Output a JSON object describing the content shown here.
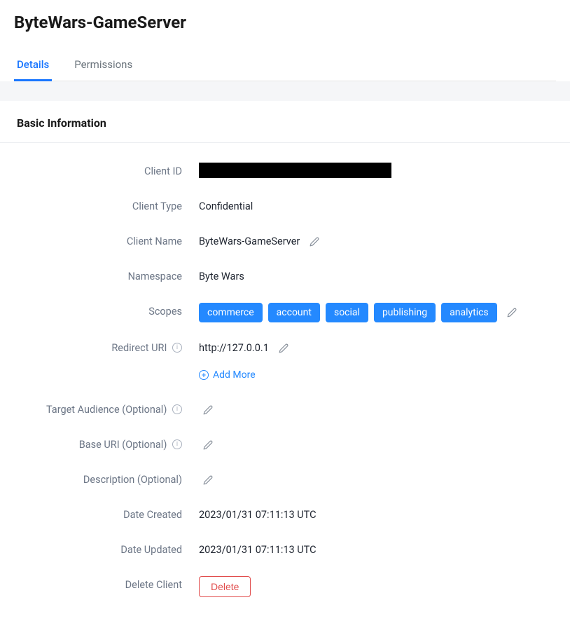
{
  "page": {
    "title": "ByteWars-GameServer"
  },
  "tabs": [
    {
      "label": "Details",
      "active": true
    },
    {
      "label": "Permissions",
      "active": false
    }
  ],
  "card": {
    "title": "Basic Information"
  },
  "fields": {
    "client_id": {
      "label": "Client ID"
    },
    "client_type": {
      "label": "Client Type",
      "value": "Confidential"
    },
    "client_name": {
      "label": "Client Name",
      "value": "ByteWars-GameServer"
    },
    "namespace": {
      "label": "Namespace",
      "value": "Byte Wars"
    },
    "scopes": {
      "label": "Scopes",
      "values": [
        "commerce",
        "account",
        "social",
        "publishing",
        "analytics"
      ]
    },
    "redirect_uri": {
      "label": "Redirect URI",
      "value": "http://127.0.0.1",
      "add_more_label": "Add More"
    },
    "target_audience": {
      "label": "Target Audience (Optional)"
    },
    "base_uri": {
      "label": "Base URI (Optional)"
    },
    "description": {
      "label": "Description (Optional)"
    },
    "date_created": {
      "label": "Date Created",
      "value": "2023/01/31 07:11:13 UTC"
    },
    "date_updated": {
      "label": "Date Updated",
      "value": "2023/01/31 07:11:13 UTC"
    },
    "delete_client": {
      "label": "Delete Client",
      "button_label": "Delete"
    }
  }
}
